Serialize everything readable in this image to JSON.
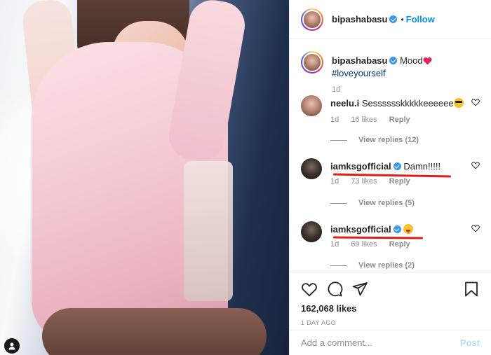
{
  "post": {
    "author": "bipashabasu",
    "follow_label": "Follow",
    "dot": "•",
    "caption": {
      "text": "Mood",
      "hashtag": "#loveyourself",
      "time": "1d"
    },
    "comments": [
      {
        "user": "neelu.i",
        "verified": false,
        "text": "Sesssssskkkkkeeeeee",
        "emoji": "sunglasses",
        "time": "1d",
        "likes": "16 likes",
        "reply": "Reply",
        "view_replies": "View replies (12)"
      },
      {
        "user": "iamksgofficial",
        "verified": true,
        "text": "Damn!!!!!",
        "emoji": "",
        "time": "1d",
        "likes": "73 likes",
        "reply": "Reply",
        "view_replies": "View replies (5)"
      },
      {
        "user": "iamksgofficial",
        "verified": true,
        "text": "",
        "emoji": "tongue",
        "time": "1d",
        "likes": "69 likes",
        "reply": "Reply",
        "view_replies": "View replies (2)"
      }
    ],
    "likes_count": "162,068 likes",
    "time_ago": "1 DAY AGO",
    "add_comment_placeholder": "Add a comment...",
    "post_label": "Post"
  },
  "colors": {
    "accent": "#0095f6",
    "highlight": "#e21b1b",
    "verified": "#3897f0"
  }
}
